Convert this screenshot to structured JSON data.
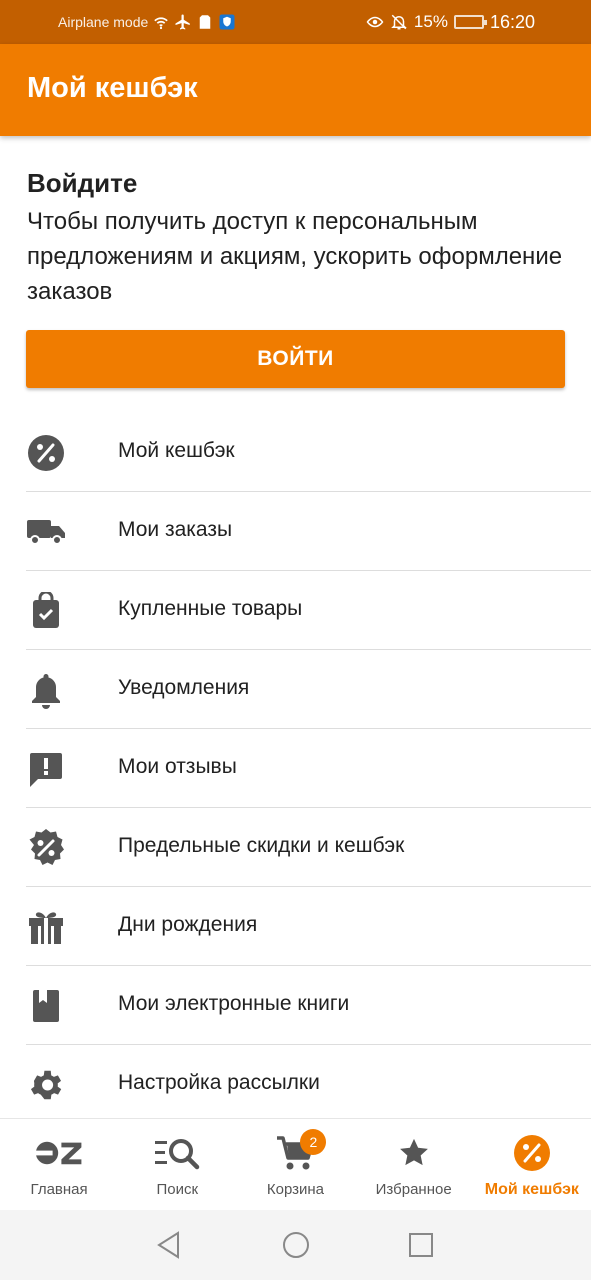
{
  "status_bar": {
    "mode_text": "Airplane mode",
    "battery": "15%",
    "time": "16:20",
    "icons": [
      "wifi-icon",
      "airplane-icon",
      "sim-icon",
      "shield-icon",
      "eye-icon",
      "bell-off-icon",
      "battery-icon"
    ]
  },
  "app_bar": {
    "title": "Мой кешбэк"
  },
  "login": {
    "title": "Войдите",
    "text": "Чтобы получить доступ к персональным предложениям и акциям, ускорить оформление заказов",
    "button_label": "ВОЙТИ"
  },
  "menu": {
    "items": [
      {
        "label": "Мой кешбэк",
        "icon": "percent-circle-icon"
      },
      {
        "label": "Мои заказы",
        "icon": "truck-icon"
      },
      {
        "label": "Купленные товары",
        "icon": "shopping-bag-check-icon"
      },
      {
        "label": "Уведомления",
        "icon": "bell-icon"
      },
      {
        "label": "Мои отзывы",
        "icon": "feedback-icon"
      },
      {
        "label": "Предельные скидки и кешбэк",
        "icon": "discount-badge-icon"
      },
      {
        "label": "Дни рождения",
        "icon": "gift-icon"
      },
      {
        "label": "Мои электронные книги",
        "icon": "book-icon"
      },
      {
        "label": "Настройка рассылки",
        "icon": "gear-icon"
      }
    ]
  },
  "bottom_nav": {
    "items": [
      {
        "label": "Главная",
        "icon": "ozon-logo-icon"
      },
      {
        "label": "Поиск",
        "icon": "search-list-icon"
      },
      {
        "label": "Корзина",
        "icon": "cart-icon",
        "badge": "2"
      },
      {
        "label": "Избранное",
        "icon": "star-icon"
      },
      {
        "label": "Мой кешбэк",
        "icon": "percent-circle-icon",
        "active": true
      }
    ]
  },
  "colors": {
    "accent": "#f07c00",
    "status_bar": "#c25f00",
    "icon": "#555555",
    "text": "#212121"
  }
}
